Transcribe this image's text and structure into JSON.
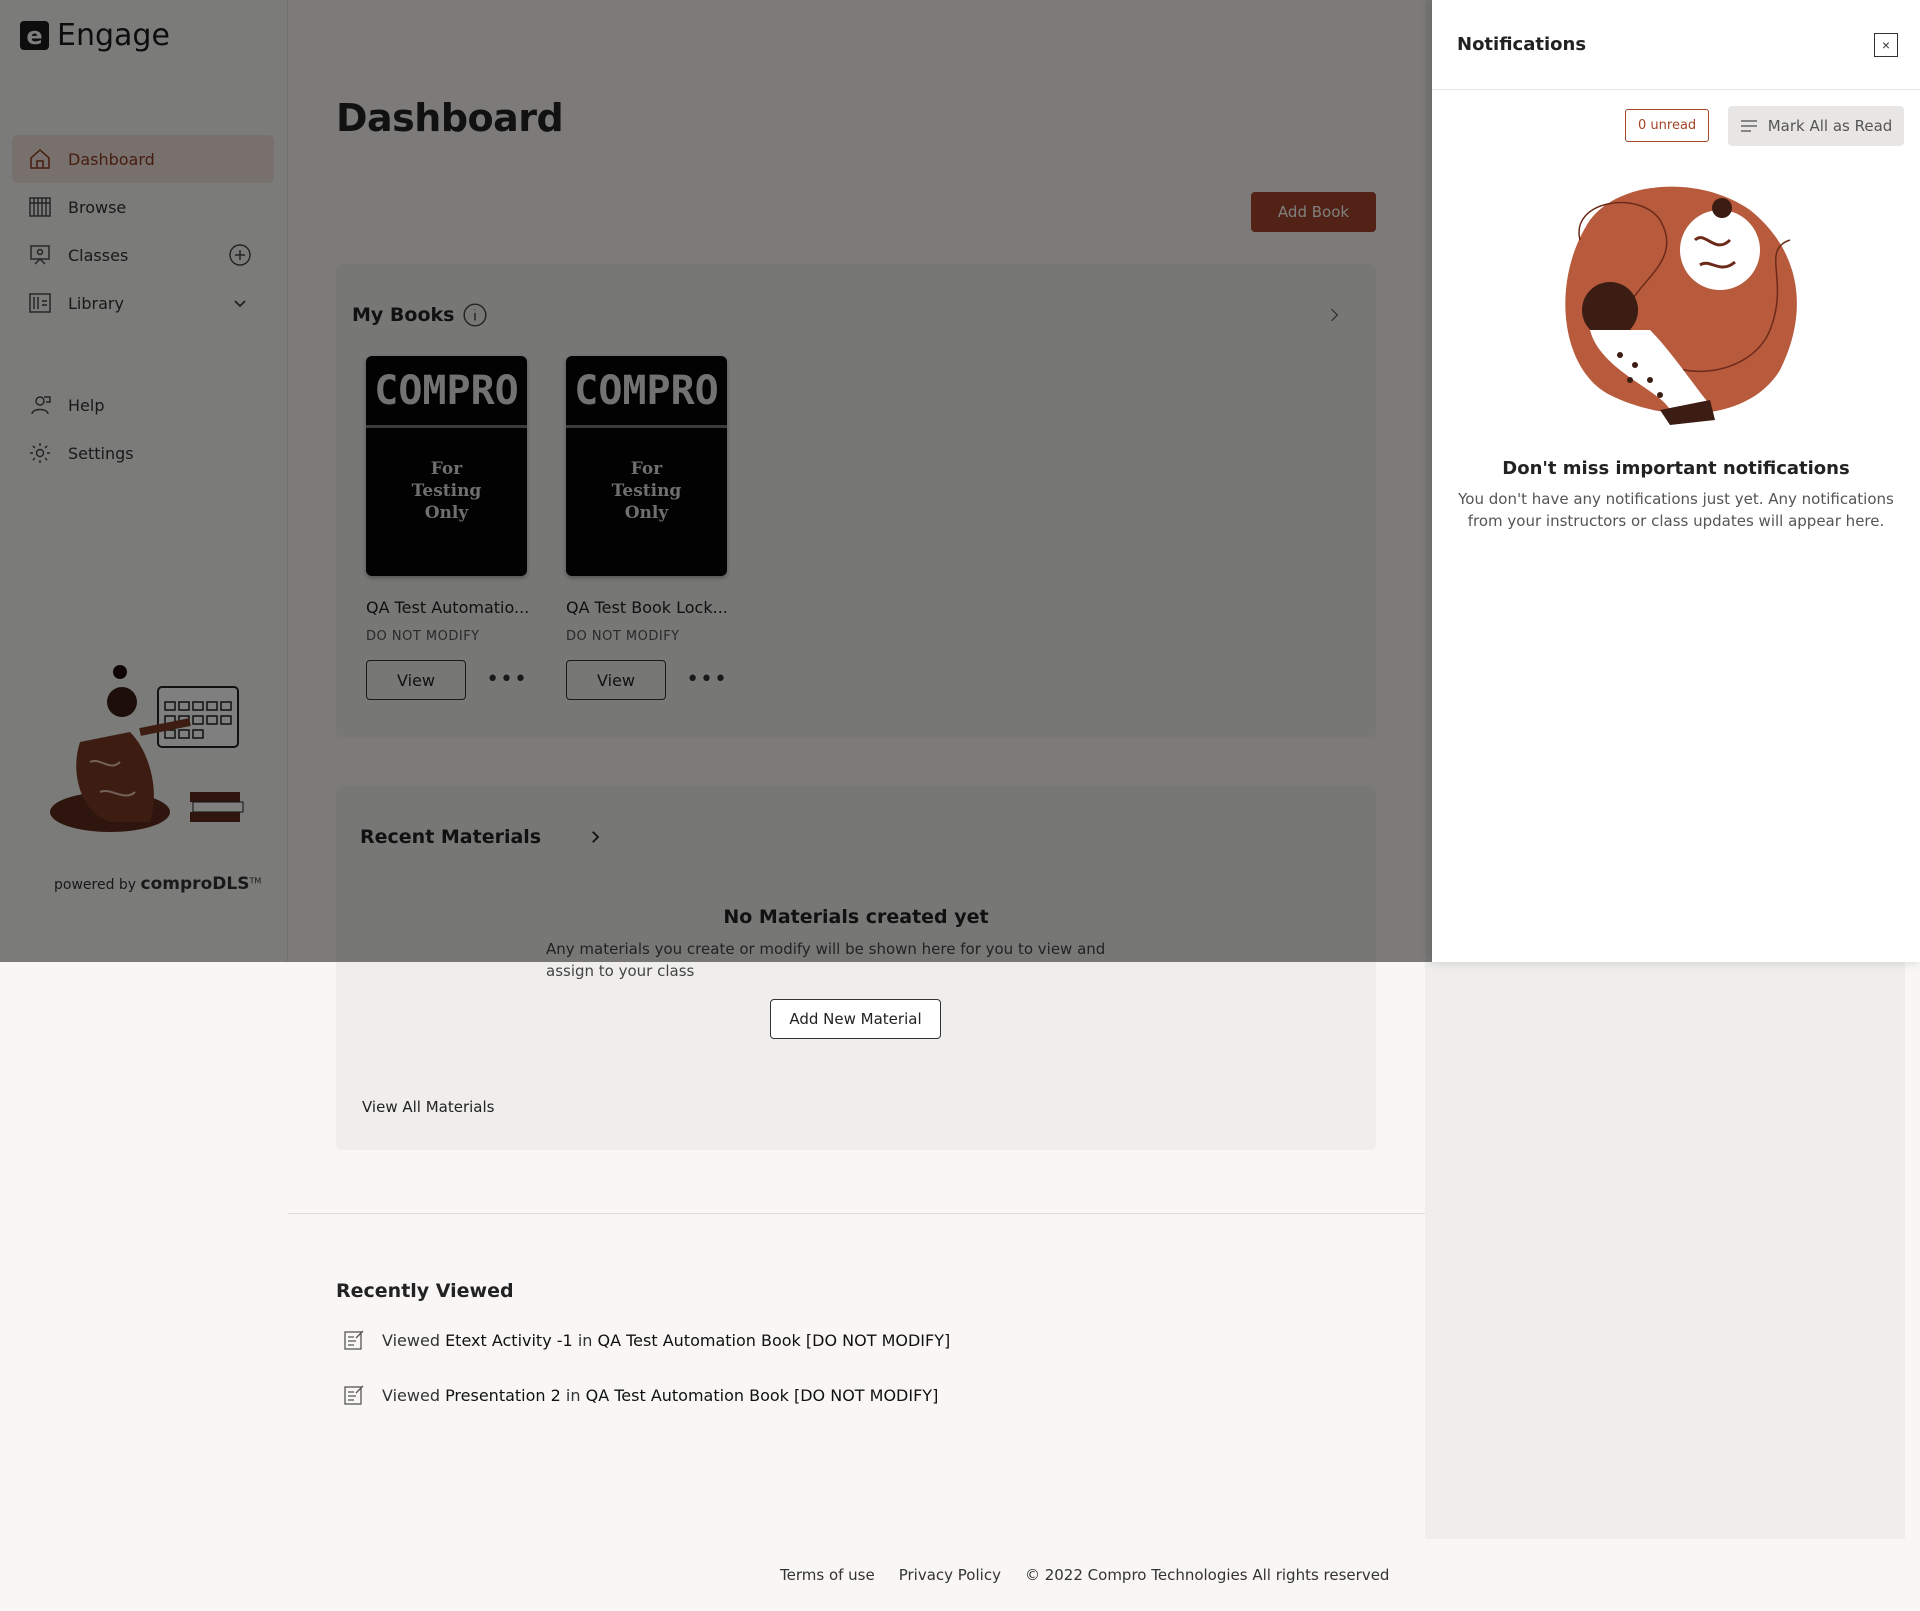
{
  "app": {
    "logo_letter": "e",
    "name": "Engage"
  },
  "sidebar": {
    "items": [
      {
        "label": "Dashboard",
        "icon": "home-icon",
        "active": true
      },
      {
        "label": "Browse",
        "icon": "books-shelf-icon"
      },
      {
        "label": "Classes",
        "icon": "classroom-icon",
        "trail_icon": "add-circle-icon"
      },
      {
        "label": "Library",
        "icon": "library-icon",
        "trail_icon": "chevron-down-icon"
      }
    ],
    "secondary": [
      {
        "label": "Help",
        "icon": "help-icon"
      },
      {
        "label": "Settings",
        "icon": "gear-icon"
      }
    ],
    "powered_prefix": "powered by",
    "powered_brand": "comproDLS",
    "powered_tm": "TM"
  },
  "main": {
    "title": "Dashboard",
    "add_book_label": "Add Book",
    "my_books": {
      "title": "My Books",
      "books": [
        {
          "cover_top": "COMPRO",
          "cover_sub": "For\nTesting\nOnly",
          "title": "QA Test Automatio...",
          "subtitle": "DO NOT MODIFY",
          "view_label": "View",
          "more": "•••"
        },
        {
          "cover_top": "COMPRO",
          "cover_sub": "For\nTesting\nOnly",
          "title": "QA Test Book Lock...",
          "subtitle": "DO NOT MODIFY",
          "view_label": "View",
          "more": "•••"
        }
      ]
    },
    "recent_materials": {
      "title": "Recent Materials",
      "empty_title": "No Materials created yet",
      "empty_desc": "Any materials you create or modify will be shown here for you to view and assign to your class",
      "add_label": "Add New Material",
      "view_all_label": "View All Materials"
    },
    "recently_viewed": {
      "title": "Recently Viewed",
      "items": [
        {
          "prefix": "Viewed",
          "item": "Etext Activity -1",
          "joiner": "in",
          "book": "QA Test Automation Book [DO NOT MODIFY]"
        },
        {
          "prefix": "Viewed",
          "item": "Presentation 2",
          "joiner": "in",
          "book": "QA Test Automation Book [DO NOT MODIFY]"
        }
      ]
    }
  },
  "footer": {
    "terms": "Terms of use",
    "privacy": "Privacy Policy",
    "copyright": "© 2022 Compro Technologies All rights reserved"
  },
  "notifications": {
    "title": "Notifications",
    "close": "×",
    "unread_label": "0 unread",
    "mark_all_label": "Mark All as Read",
    "empty_title": "Don't miss important notifications",
    "empty_desc": "You don't have any notifications just yet. Any notifications from your instructors or class updates will appear here."
  },
  "colors": {
    "accent": "#a3452b",
    "active_bg": "#efe0d8",
    "overlay": "rgba(0,0,0,0.5)"
  }
}
